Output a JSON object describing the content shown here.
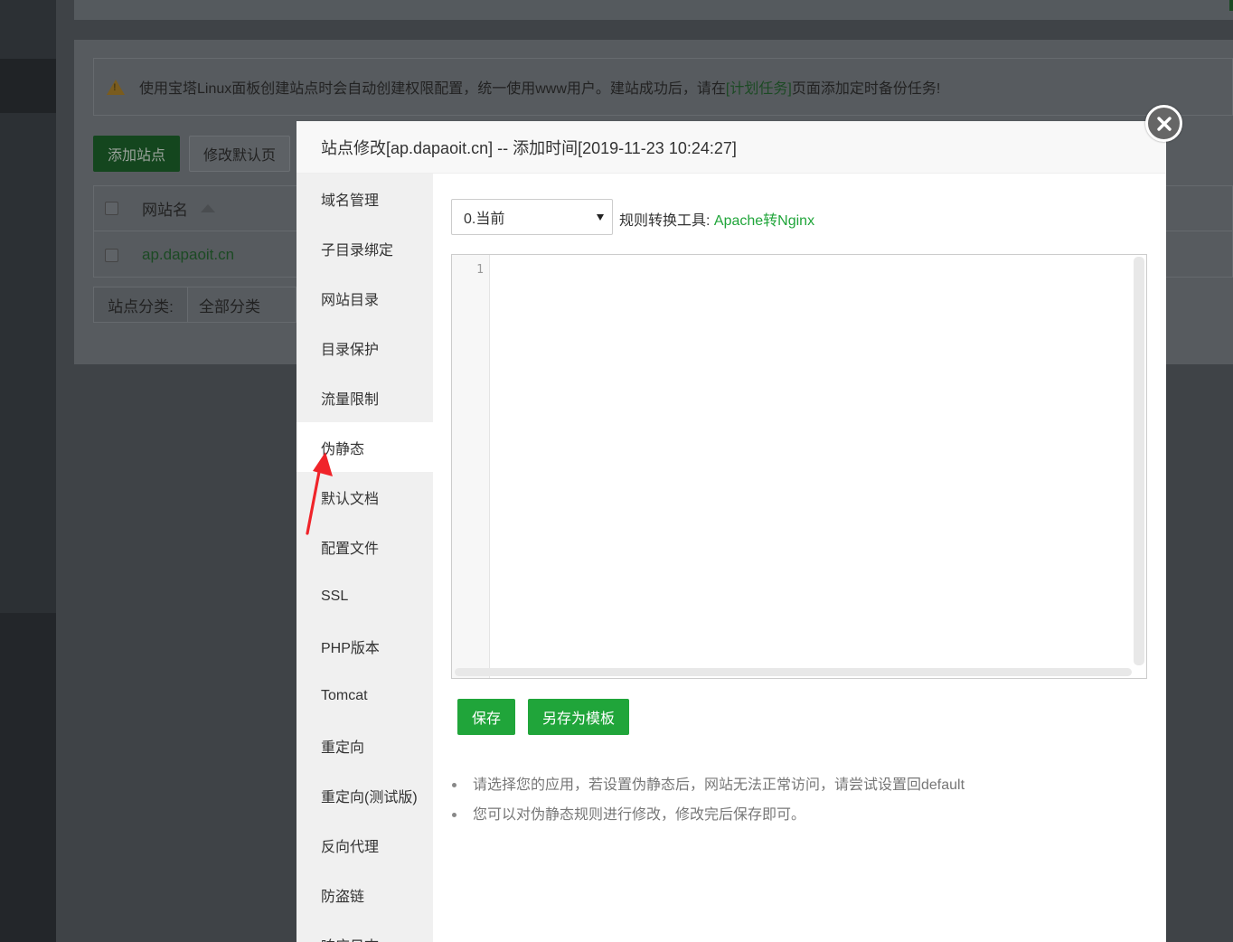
{
  "background": {
    "tip_prefix": "使用宝塔Linux面板创建站点时会自动创建权限配置，统一使用www用户。建站成功后，请在",
    "tip_link": "[计划任务]",
    "tip_suffix": "页面添加定时备份任务!",
    "add_site_button": "添加站点",
    "modify_default_button": "修改默认页",
    "table_header_site": "网站名",
    "site_row_name": "ap.dapaoit.cn",
    "category_label": "站点分类:",
    "category_value": "全部分类"
  },
  "modal": {
    "title": "站点修改[ap.dapaoit.cn] -- 添加时间[2019-11-23 10:24:27]",
    "nav_items": [
      "域名管理",
      "子目录绑定",
      "网站目录",
      "目录保护",
      "流量限制",
      "伪静态",
      "默认文档",
      "配置文件",
      "SSL",
      "PHP版本",
      "Tomcat",
      "重定向",
      "重定向(测试版)",
      "反向代理",
      "防盗链",
      "响应日志"
    ],
    "active_nav_index": 5,
    "template_select_value": "0.当前",
    "tool_label": "规则转换工具:",
    "tool_link": "Apache转Nginx",
    "editor_line_number": "1",
    "save_button": "保存",
    "save_as_template_button": "另存为模板",
    "tips": [
      "请选择您的应用，若设置伪静态后，网站无法正常访问，请尝试设置回default",
      "您可以对伪静态规则进行修改，修改完后保存即可。"
    ]
  },
  "colors": {
    "accent_green": "#20a53a",
    "annotation_arrow": "#f0242a"
  },
  "icons": {
    "close": "close-icon",
    "warning": "warning-icon",
    "dropdown": "caret-down-icon"
  }
}
